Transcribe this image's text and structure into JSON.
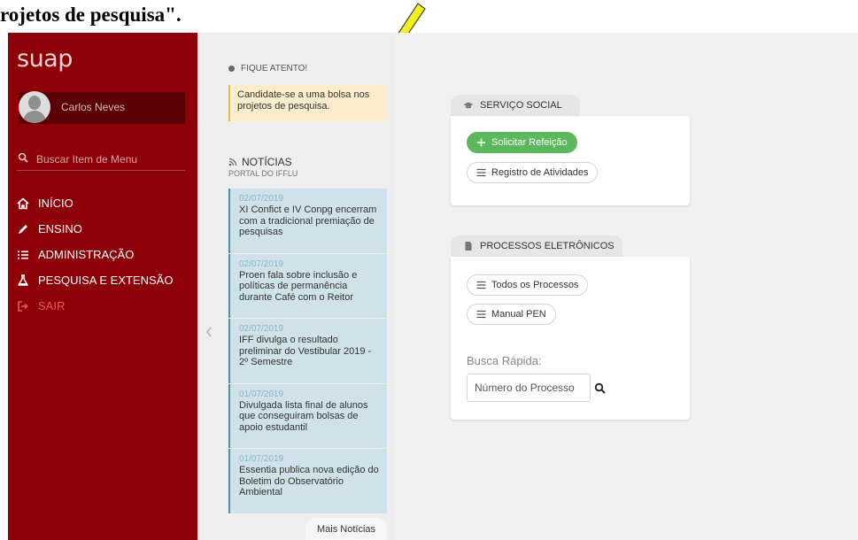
{
  "caption": {
    "text": "rojetos de pesquisa\"."
  },
  "sidebar": {
    "logo": "suap",
    "user_name": "Carlos Neves",
    "search_placeholder": "Buscar Item de Menu",
    "menu": [
      {
        "label": "INÍCIO",
        "icon": "home-icon"
      },
      {
        "label": "ENSINO",
        "icon": "pencil-icon"
      },
      {
        "label": "ADMINISTRAÇÃO",
        "icon": "list-icon"
      },
      {
        "label": "PESQUISA E EXTENSÃO",
        "icon": "flask-icon"
      },
      {
        "label": "SAIR",
        "icon": "sign-out-icon"
      }
    ],
    "bg_color": "#8e0008",
    "exit_color": "#e05a5a"
  },
  "attention": {
    "title": "FIQUE ATENTO!",
    "message": "Candidate-se a uma bolsa nos projetos de pesquisa."
  },
  "news": {
    "title": "NOTÍCIAS",
    "subtitle": "PORTAL DO IFFLU",
    "items": [
      {
        "date": "02/07/2019",
        "text": "XI Confict e IV Conpg encerram com a tradicional premiação de pesquisas"
      },
      {
        "date": "02/07/2019",
        "text": "Proen fala sobre inclusão e políticas de permanência durante Café com o Reitor"
      },
      {
        "date": "02/07/2019",
        "text": "IFF divulga o resultado preliminar do Vestibular 2019 - 2º Semestre"
      },
      {
        "date": "01/07/2019",
        "text": "Divulgada lista final de alunos que conseguiram bolsas de apoio estudantil"
      },
      {
        "date": "01/07/2019",
        "text": "Essentia publica nova edição do Boletim do Observatório Ambiental"
      }
    ],
    "more_label": "Mais Notícias"
  },
  "servico_social": {
    "title": "SERVIÇO SOCIAL",
    "buttons": [
      {
        "label": "Solicitar Refeição",
        "icon": "plus-icon"
      },
      {
        "label": "Registro de Atividades",
        "icon": "list-icon"
      }
    ],
    "accent_color": "#5cb85c"
  },
  "processos": {
    "title": "PROCESSOS ELETRÔNICOS",
    "buttons": [
      {
        "label": "Todos os Processos",
        "icon": "list-icon"
      },
      {
        "label": "Manual PEN",
        "icon": "list-icon"
      }
    ],
    "busca_label": "Busca Rápida:",
    "search_placeholder": "Número do Processo"
  }
}
